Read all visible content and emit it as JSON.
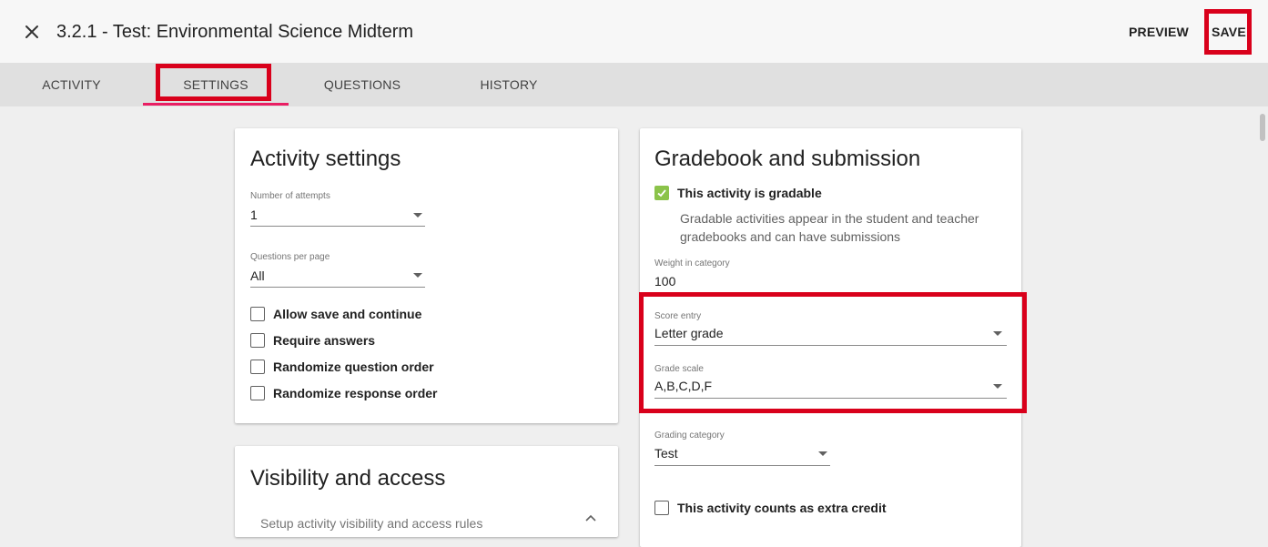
{
  "header": {
    "title": "3.2.1 - Test: Environmental Science Midterm",
    "preview_label": "PREVIEW",
    "save_label": "SAVE"
  },
  "tabs": [
    {
      "label": "ACTIVITY"
    },
    {
      "label": "SETTINGS",
      "active": true
    },
    {
      "label": "QUESTIONS"
    },
    {
      "label": "HISTORY"
    }
  ],
  "activity_settings": {
    "title": "Activity settings",
    "attempts": {
      "label": "Number of attempts",
      "value": "1"
    },
    "per_page": {
      "label": "Questions per page",
      "value": "All"
    },
    "checkboxes": [
      {
        "label": "Allow save and continue",
        "checked": false
      },
      {
        "label": "Require answers",
        "checked": false
      },
      {
        "label": "Randomize question order",
        "checked": false
      },
      {
        "label": "Randomize response order",
        "checked": false
      }
    ]
  },
  "visibility": {
    "title": "Visibility and access",
    "subtitle": "Setup activity visibility and access rules"
  },
  "gradebook": {
    "title": "Gradebook and submission",
    "gradable": {
      "label": "This activity is gradable",
      "checked": true
    },
    "gradable_help": "Gradable activities appear in the student and teacher gradebooks and can have submissions",
    "weight": {
      "label": "Weight in category",
      "value": "100"
    },
    "score_entry": {
      "label": "Score entry",
      "value": "Letter grade"
    },
    "grade_scale": {
      "label": "Grade scale",
      "value": "A,B,C,D,F"
    },
    "category": {
      "label": "Grading category",
      "value": "Test"
    },
    "extra_credit": {
      "label": "This activity counts as extra credit",
      "checked": false
    }
  },
  "colors": {
    "highlight_red": "#d9001b",
    "tab_indicator": "#e91e63",
    "check_green": "#8bc34a"
  },
  "icons": {
    "close": "close-icon",
    "caret": "caret-down-icon",
    "chevron": "chevron-up-icon",
    "check": "check-icon"
  }
}
